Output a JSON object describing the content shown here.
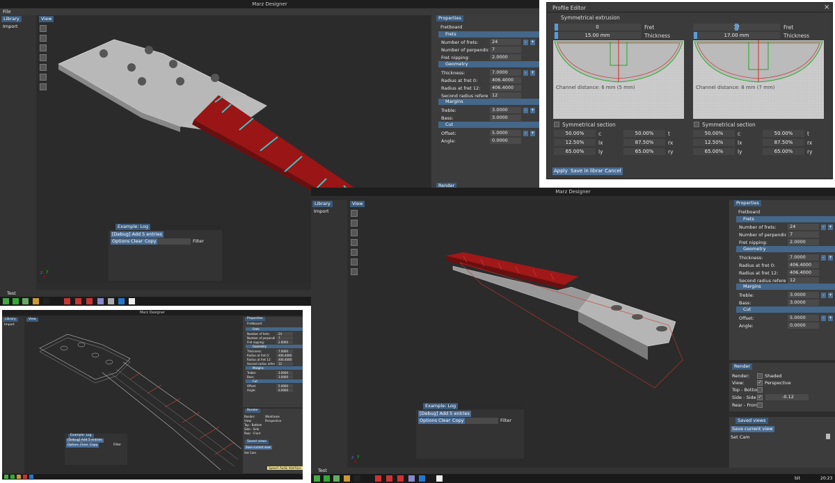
{
  "app_title": "Marz Designer",
  "menu": {
    "file": "File"
  },
  "tabs": {
    "library": "Library",
    "view": "View",
    "properties": "Properties",
    "render": "Render",
    "saved_views": "Saved views",
    "test": "Test"
  },
  "library": {
    "import": "Import"
  },
  "properties": {
    "title": "Fretboard",
    "groups": {
      "frets": "Frets",
      "geometry": "Geometry",
      "margins": "Margins",
      "cut": "Cut"
    },
    "rows": {
      "num_frets": {
        "label": "Number of frets:",
        "value": "24"
      },
      "num_perp": {
        "label": "Number of perpendicular fre",
        "value": "7"
      },
      "fret_nipping": {
        "label": "Fret nipping:",
        "value": "2.0000"
      },
      "thickness": {
        "label": "Thickness:",
        "value": "7.0000"
      },
      "radius0": {
        "label": "Radius at fret 0:",
        "value": "406.4000"
      },
      "radius12": {
        "label": "Radius at fret 12:",
        "value": "406.4000"
      },
      "second_radius": {
        "label": "Second radius reference fre",
        "value": "12"
      },
      "treble": {
        "label": "Treble:",
        "value": "3.0000"
      },
      "bass": {
        "label": "Bass:",
        "value": "3.0000"
      },
      "offset": {
        "label": "Offset:",
        "value": "5.0000"
      },
      "angle": {
        "label": "Angle:",
        "value": "0.0000"
      }
    },
    "minus": "-",
    "plus": "+"
  },
  "render": {
    "render_label": "Render:",
    "shaded": "Shaded",
    "view_label": "View:",
    "perspective": "Perspective",
    "top_bottom": "Top - Bottom",
    "side_side": "Side - Side",
    "side_value": "-0.12",
    "rear_front": "Rear - Front",
    "wireframe": "Wireframe"
  },
  "saved_views": {
    "save_current": "Save current view",
    "set_cam": "Set Cam"
  },
  "log": {
    "title": "Example: Log",
    "debug_line": "[Debug] Add 5 entries",
    "options": "Options",
    "clear": "Clear",
    "copy": "Copy",
    "filter": "Filter"
  },
  "profile_editor": {
    "title": "Profile Editor",
    "close": "×",
    "symmetrical_extrusion": "Symmetrical extrusion",
    "fret_label": "Fret",
    "thickness_label": "Thickness",
    "left": {
      "fret": "0",
      "thickness": "15.00 mm",
      "channel": "Channel distance: 6 mm (5 mm)"
    },
    "right": {
      "fret": "12",
      "thickness": "17.00 mm",
      "channel": "Channel distance: 8 mm (7 mm)"
    },
    "symmetrical_section": "Symmetrical section",
    "section_left": [
      {
        "a": "50.00%",
        "a_label": "c",
        "b": "50.00%",
        "b_label": "t"
      },
      {
        "a": "12.50%",
        "a_label": "lx",
        "b": "87.50%",
        "b_label": "rx"
      },
      {
        "a": "65.00%",
        "a_label": "ly",
        "b": "65.00%",
        "b_label": "ry"
      }
    ],
    "section_right": [
      {
        "a": "50.00%",
        "a_label": "c",
        "b": "50.00%",
        "b_label": "t"
      },
      {
        "a": "12.50%",
        "a_label": "lx",
        "b": "87.50%",
        "b_label": "rx"
      },
      {
        "a": "65.00%",
        "a_label": "ly",
        "b": "65.00%",
        "b_label": "ry"
      }
    ],
    "apply": "Apply",
    "save_library": "Save in library",
    "cancel": "Cancel"
  },
  "tooltip": "Speech Audio Interface",
  "tray": {
    "time": "20:23",
    "lang": "bit"
  },
  "colors": {
    "accent": "#44678a",
    "fretboard": "#a01818",
    "wire_red": "#c04040"
  }
}
